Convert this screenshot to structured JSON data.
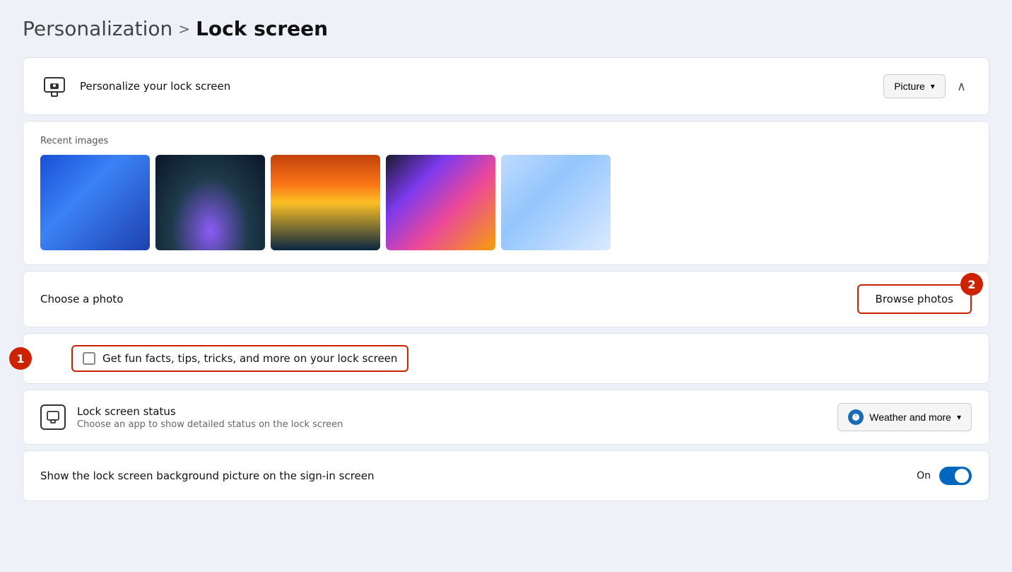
{
  "breadcrumb": {
    "parent": "Personalization",
    "separator": ">",
    "current": "Lock screen"
  },
  "personalize_card": {
    "title": "Personalize your lock screen",
    "dropdown_value": "Picture",
    "dropdown_chevron": "▾",
    "collapse_chevron": "∧"
  },
  "recent_images": {
    "label": "Recent images",
    "images": [
      {
        "id": 1,
        "alt": "Blue abstract wallpaper"
      },
      {
        "id": 2,
        "alt": "Dark teal with purple glow"
      },
      {
        "id": 3,
        "alt": "Sunset over water"
      },
      {
        "id": 4,
        "alt": "Colorful ribbons on dark"
      },
      {
        "id": 5,
        "alt": "Light blue abstract"
      }
    ]
  },
  "choose_photo": {
    "label": "Choose a photo",
    "browse_button": "Browse photos",
    "badge": "2"
  },
  "fun_facts": {
    "checkbox_label": "Get fun facts, tips, tricks, and more on your lock screen",
    "checked": false,
    "badge": "1"
  },
  "lock_screen_status": {
    "title": "Lock screen status",
    "subtitle": "Choose an app to show detailed status on the lock screen",
    "dropdown_value": "Weather and more",
    "dropdown_chevron": "▾"
  },
  "sign_in_screen": {
    "label": "Show the lock screen background picture on the sign-in screen",
    "status": "On",
    "toggle_on": true
  }
}
